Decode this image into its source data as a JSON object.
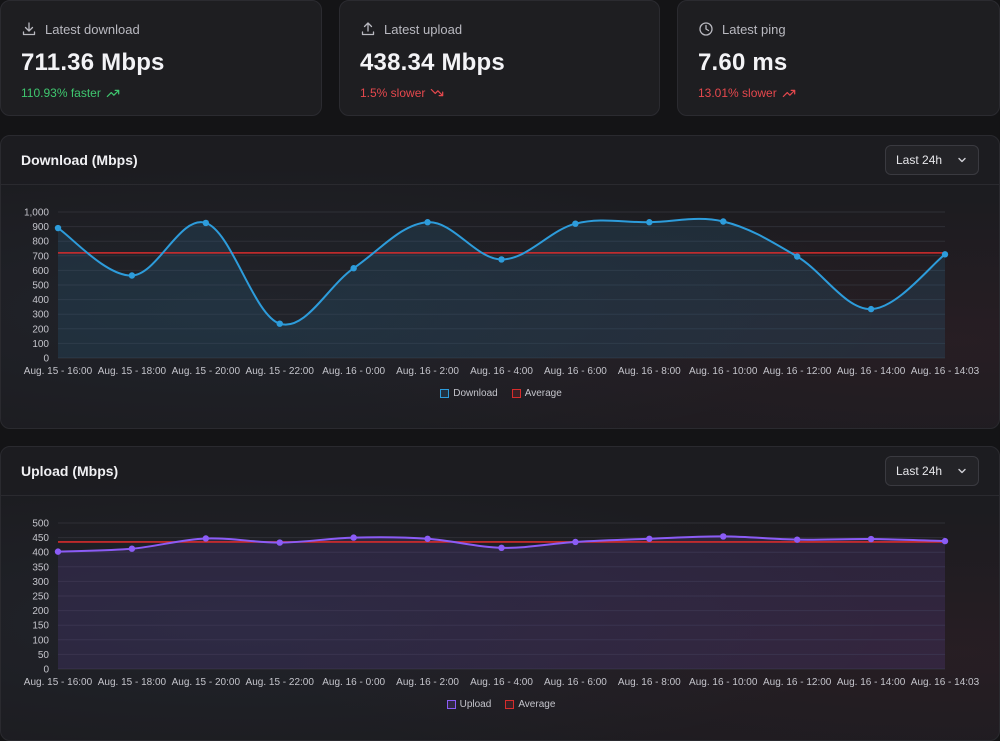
{
  "stats": [
    {
      "label": "Latest download",
      "icon": "download-icon",
      "value": "711.36 Mbps",
      "delta": "110.93% faster",
      "trend": "up",
      "status": "good"
    },
    {
      "label": "Latest upload",
      "icon": "upload-icon",
      "value": "438.34 Mbps",
      "delta": "1.5% slower",
      "trend": "down",
      "status": "bad"
    },
    {
      "label": "Latest ping",
      "icon": "clock-icon",
      "value": "7.60 ms",
      "delta": "13.01% slower",
      "trend": "up",
      "status": "bad"
    }
  ],
  "colors": {
    "good": "#3fc76f",
    "bad": "#e5484d",
    "download": "#2d9cdb",
    "upload": "#8b5cf6",
    "average": "#d62c2c"
  },
  "download_panel": {
    "title": "Download (Mbps)",
    "range": "Last 24h"
  },
  "upload_panel": {
    "title": "Upload (Mbps)",
    "range": "Last 24h"
  },
  "chart_data": [
    {
      "type": "line",
      "title": "Download (Mbps)",
      "categories": [
        "Aug. 15 - 16:00",
        "Aug. 15 - 18:00",
        "Aug. 15 - 20:00",
        "Aug. 15 - 22:00",
        "Aug. 16 - 0:00",
        "Aug. 16 - 2:00",
        "Aug. 16 - 4:00",
        "Aug. 16 - 6:00",
        "Aug. 16 - 8:00",
        "Aug. 16 - 10:00",
        "Aug. 16 - 12:00",
        "Aug. 16 - 14:00",
        "Aug. 16 - 14:03"
      ],
      "series": [
        {
          "name": "Download",
          "values": [
            890,
            565,
            925,
            235,
            615,
            930,
            675,
            920,
            930,
            935,
            695,
            335,
            710
          ],
          "color": "#2d9cdb",
          "filled": true
        },
        {
          "name": "Average",
          "values": [
            720,
            720,
            720,
            720,
            720,
            720,
            720,
            720,
            720,
            720,
            720,
            720,
            720
          ],
          "color": "#d62c2c"
        }
      ],
      "ylim": [
        0,
        1000
      ],
      "yticks": [
        "0",
        "100",
        "200",
        "300",
        "400",
        "500",
        "600",
        "700",
        "800",
        "900",
        "1,000"
      ],
      "ytick_values": [
        0,
        100,
        200,
        300,
        400,
        500,
        600,
        700,
        800,
        900,
        1000
      ],
      "legend": "bottom",
      "grid": true
    },
    {
      "type": "line",
      "title": "Upload (Mbps)",
      "categories": [
        "Aug. 15 - 16:00",
        "Aug. 15 - 18:00",
        "Aug. 15 - 20:00",
        "Aug. 15 - 22:00",
        "Aug. 16 - 0:00",
        "Aug. 16 - 2:00",
        "Aug. 16 - 4:00",
        "Aug. 16 - 6:00",
        "Aug. 16 - 8:00",
        "Aug. 16 - 10:00",
        "Aug. 16 - 12:00",
        "Aug. 16 - 14:00",
        "Aug. 16 - 14:03"
      ],
      "series": [
        {
          "name": "Upload",
          "values": [
            402,
            412,
            447,
            433,
            450,
            446,
            415,
            435,
            446,
            454,
            443,
            445,
            438
          ],
          "color": "#8b5cf6",
          "filled": true
        },
        {
          "name": "Average",
          "values": [
            435,
            435,
            435,
            435,
            435,
            435,
            435,
            435,
            435,
            435,
            435,
            435,
            435
          ],
          "color": "#d62c2c"
        }
      ],
      "ylim": [
        0,
        500
      ],
      "yticks": [
        "0",
        "50",
        "100",
        "150",
        "200",
        "250",
        "300",
        "350",
        "400",
        "450",
        "500"
      ],
      "ytick_values": [
        0,
        50,
        100,
        150,
        200,
        250,
        300,
        350,
        400,
        450,
        500
      ],
      "legend": "bottom",
      "grid": true
    }
  ]
}
